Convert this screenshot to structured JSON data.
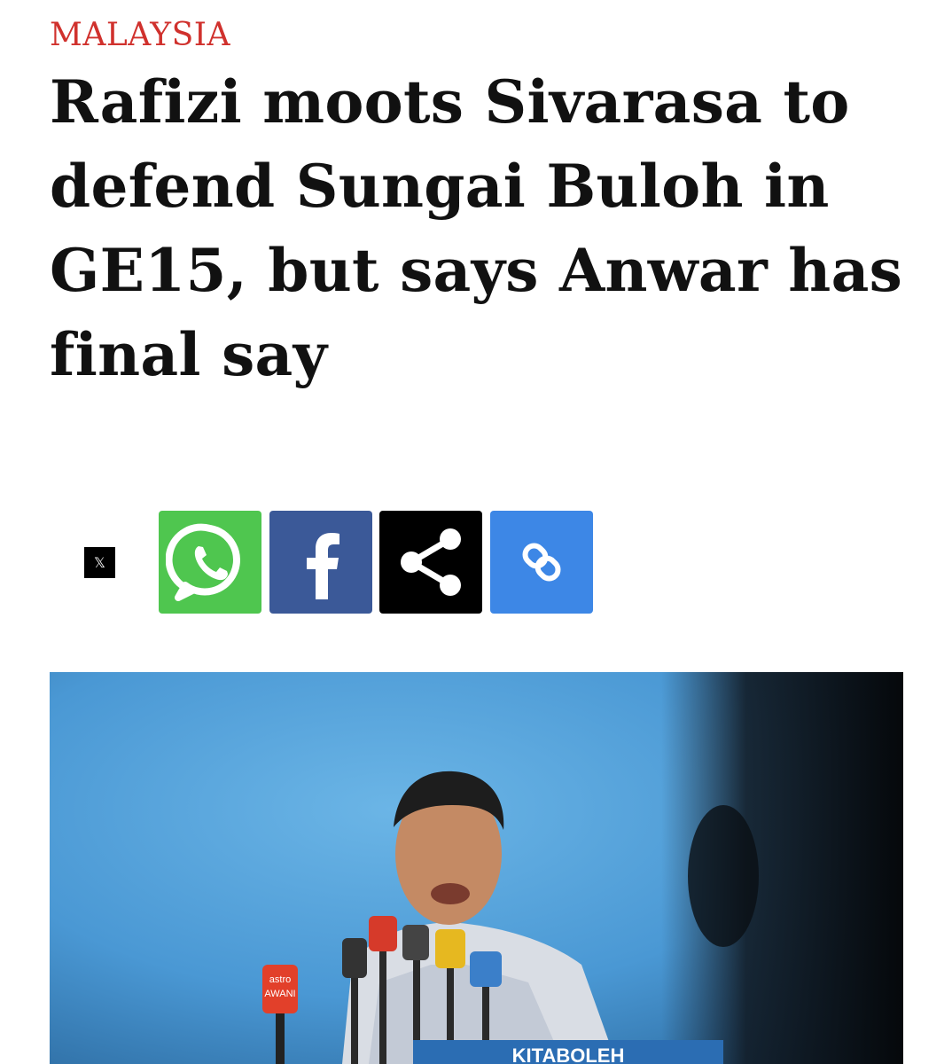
{
  "article": {
    "category": "MALAYSIA",
    "headline": "Rafizi moots Sivarasa to defend Sungai Buloh in GE15, but says Anwar has final say"
  },
  "share": {
    "x_label": "𝕏",
    "buttons": [
      {
        "icon": "whatsapp-icon",
        "color": "#4fc64f"
      },
      {
        "icon": "facebook-icon",
        "color": "#3b5998"
      },
      {
        "icon": "share-icon",
        "color": "#000000"
      },
      {
        "icon": "link-icon",
        "color": "#3d87e6"
      }
    ]
  },
  "photo": {
    "mic_labels": [
      "astro",
      "AWANI"
    ],
    "banner_text": "KITABOLEH"
  },
  "colors": {
    "category": "#d0312d",
    "headline": "#111111",
    "photo_background": "#4b9bd6"
  }
}
